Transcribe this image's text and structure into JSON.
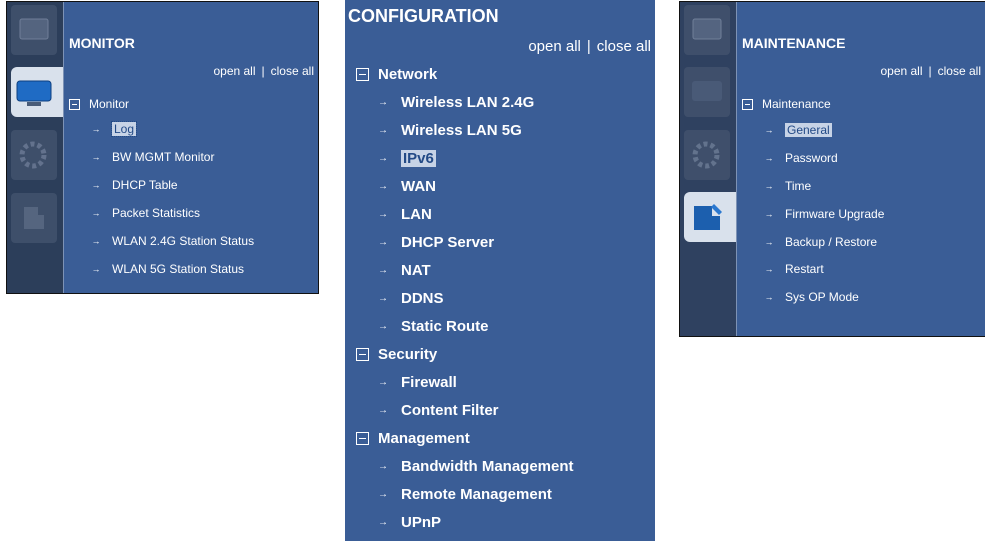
{
  "monitor": {
    "title": "MONITOR",
    "open_all": "open all",
    "close_all": "close all",
    "separator": "|",
    "group": "Monitor",
    "items": [
      "Log",
      "BW MGMT Monitor",
      "DHCP Table",
      "Packet Statistics",
      "WLAN 2.4G Station Status",
      "WLAN 5G Station Status"
    ],
    "selected": "Log"
  },
  "configuration": {
    "title": "CONFIGURATION",
    "open_all": "open all",
    "close_all": "close all",
    "separator": "|",
    "groups": [
      {
        "label": "Network",
        "items": [
          "Wireless LAN 2.4G",
          "Wireless LAN 5G",
          "IPv6",
          "WAN",
          "LAN",
          "DHCP Server",
          "NAT",
          "DDNS",
          "Static Route"
        ]
      },
      {
        "label": "Security",
        "items": [
          "Firewall",
          "Content Filter"
        ]
      },
      {
        "label": "Management",
        "items": [
          "Bandwidth Management",
          "Remote Management",
          "UPnP"
        ]
      }
    ],
    "selected": "IPv6"
  },
  "maintenance": {
    "title": "MAINTENANCE",
    "open_all": "open all",
    "close_all": "close all",
    "separator": "|",
    "group": "Maintenance",
    "items": [
      "General",
      "Password",
      "Time",
      "Firmware Upgrade",
      "Backup / Restore",
      "Restart",
      "Sys OP Mode"
    ],
    "selected": "General"
  },
  "glyphs": {
    "arrow": "→",
    "collapse": "⊟"
  },
  "colors": {
    "panel": "#3a5d96",
    "rail": "#2c3e5a",
    "highlight": "#c7d3e6",
    "text": "#ffffff"
  }
}
